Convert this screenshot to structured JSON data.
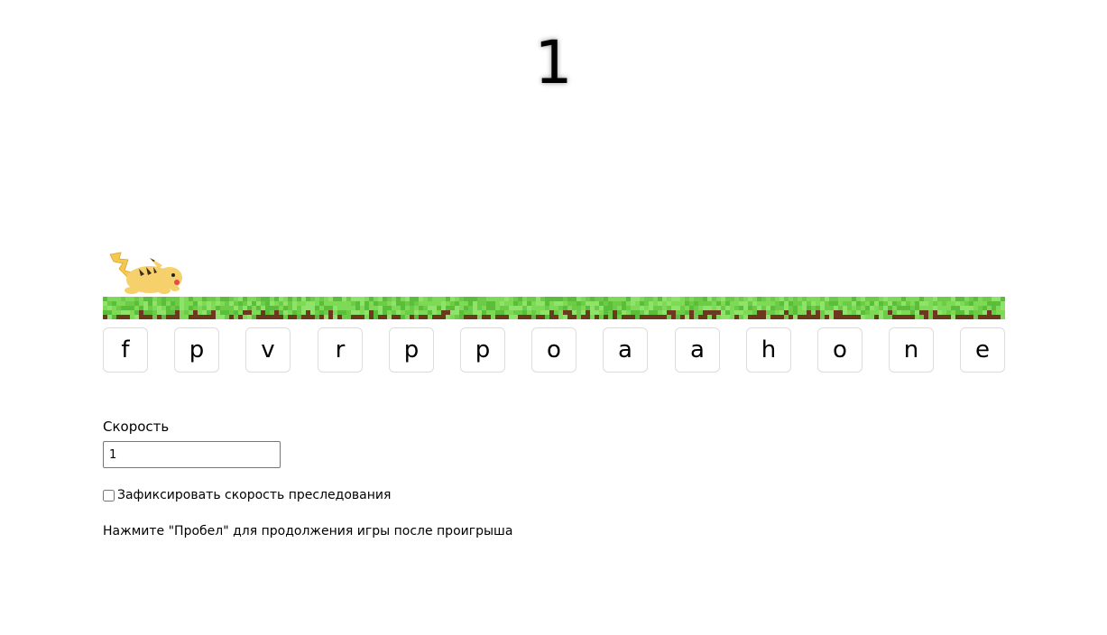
{
  "game": {
    "score": "1",
    "letters": [
      "f",
      "p",
      "v",
      "r",
      "p",
      "p",
      "o",
      "a",
      "a",
      "h",
      "o",
      "n",
      "e"
    ],
    "runner_icon": "pikachu-icon",
    "ground_colors": {
      "grass": "#7ED957",
      "grass_dark": "#5BBE3A",
      "dirt": "#6B3A1E"
    }
  },
  "controls": {
    "speed_label": "Скорость",
    "speed_value": "1",
    "fix_speed_label": "Зафиксировать скорость преследования",
    "fix_speed_checked": false,
    "hint": "Нажмите \"Пробел\" для продолжения игры после проигрыша"
  }
}
